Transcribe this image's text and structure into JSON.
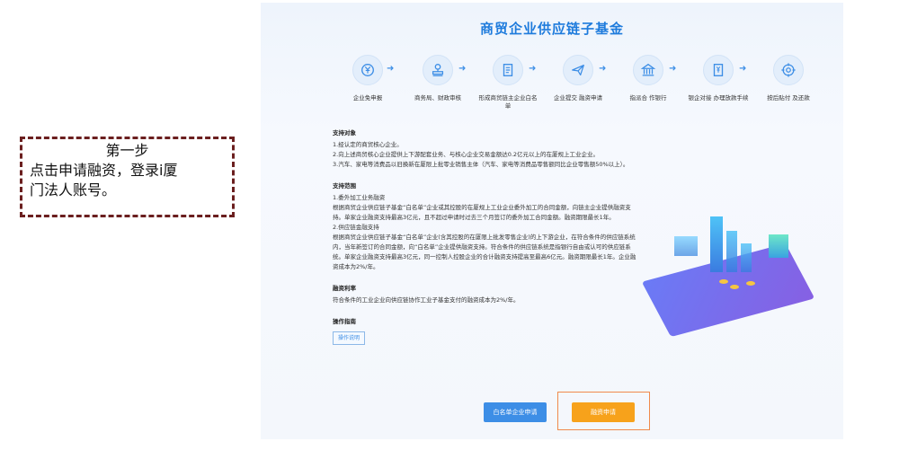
{
  "annotation": {
    "line1": "第一步",
    "line2": "点击申请融资，登录i厦",
    "line3": "门法人账号。"
  },
  "page_title": "商贸企业供应链子基金",
  "steps": [
    {
      "label": "企业免申报",
      "icon": "yen-coin-icon"
    },
    {
      "label": "商务局、财政审核",
      "icon": "stamp-icon"
    },
    {
      "label": "形成商贸链主企业白名单",
      "icon": "document-list-icon"
    },
    {
      "label": "企业提交 融资申请",
      "icon": "paper-plane-icon"
    },
    {
      "label": "指派合 作银行",
      "icon": "bank-icon"
    },
    {
      "label": "银企对接 办理放款手续",
      "icon": "yen-document-icon"
    },
    {
      "label": "按后贴付 及还款",
      "icon": "target-icon"
    }
  ],
  "sections": {
    "support_target": {
      "title": "支持对象",
      "items": [
        "1.经认定的商贸核心企业。",
        "2.向上述商贸核心企业提供上下游配套业务、与核心企业交易金额达0.2亿元以上的在厦规上工业企业。",
        "3.汽车、家电等消费品以旧换新在厦限上批零业销售主体（汽车、家电等消费品零售额同比企业零售额50%以上）。"
      ]
    },
    "support_scope": {
      "title": "支持范围",
      "items": [
        "1.委外加工业务融资",
        "根据商贸企业供应链子基金“白名单”企业或其控股的在厦规上工业企业委外加工的合同金额，向链主企业提供融资支持。单家企业融资支持最高3亿元，且不超过申请时过去三个月签订的委外加工合同金额。融资期限最长1年。",
        "2.供应链金融支持",
        "根据商贸企业供应链子基金“白名单”企业(含其控股的在厦限上批发零售企业)的上下游企业，在符合条件的供应链系统内，当年新签订的合同金额，向“白名单”企业提供融资支持。符合条件的供应链系统是指银行自由或认可的供应链系统。单家企业融资支持最高3亿元，同一控制人控股企业的合计融资支持提高至最高6亿元。融资期限最长1年。企业融资成本为2%/年。"
      ]
    },
    "financing_rate": {
      "title": "融资利率",
      "items": [
        "符合条件的工业企业向供应链协作工业子基金支付的融资成本为2%/年。"
      ]
    },
    "guide": {
      "title": "操作指南",
      "tag": "操作说明"
    }
  },
  "buttons": {
    "whitelist_apply": "白名单企业申请",
    "financing_apply": "融资申请"
  },
  "colors": {
    "accent": "#1e7bdc",
    "button_blue": "#3d8ee6",
    "button_orange": "#f7a21b",
    "annotation_border": "#6b1f1f",
    "highlight_border": "#f08a4b"
  }
}
